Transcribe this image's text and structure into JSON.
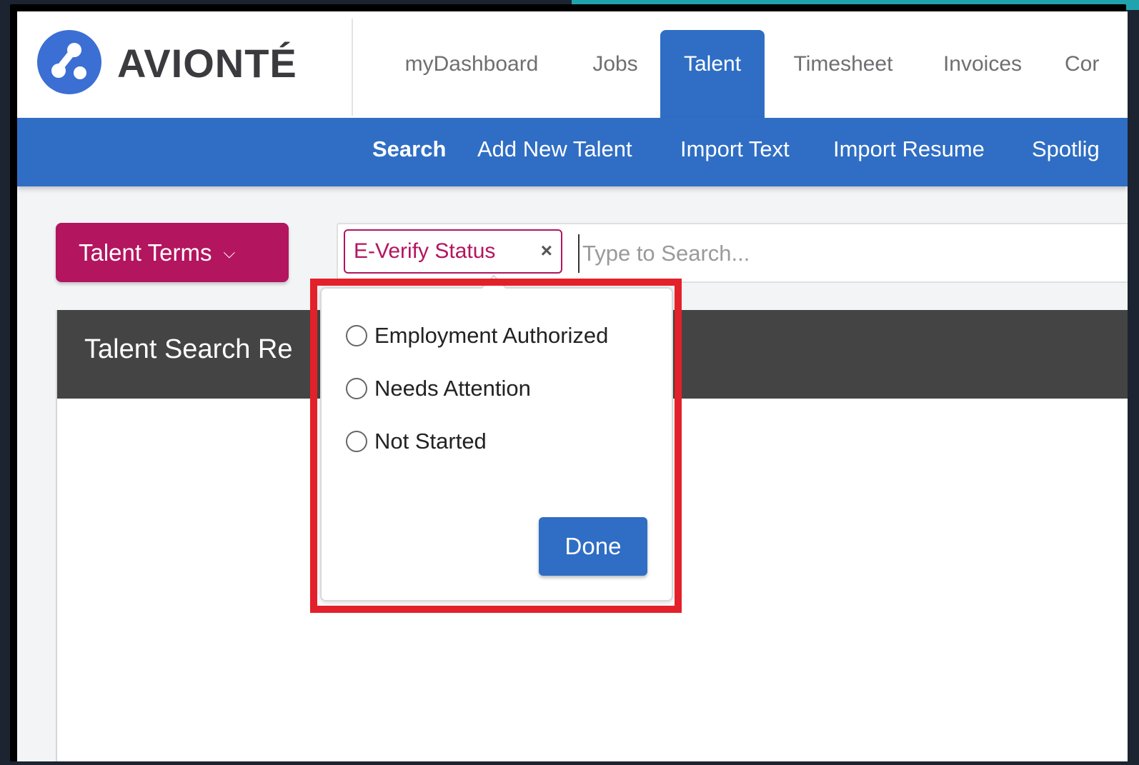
{
  "brand": {
    "name": "AVIONTÉ",
    "accent": "#2f6ec4",
    "secondary": "#b3155f"
  },
  "main_nav": {
    "tabs": [
      {
        "label": "myDashboard",
        "active": false
      },
      {
        "label": "Jobs",
        "active": false
      },
      {
        "label": "Talent",
        "active": true
      },
      {
        "label": "Timesheet",
        "active": false
      },
      {
        "label": "Invoices",
        "active": false
      },
      {
        "label": "Cor",
        "active": false
      }
    ]
  },
  "sub_nav": {
    "links": [
      {
        "label": "Search",
        "active": true
      },
      {
        "label": "Add New Talent",
        "active": false
      },
      {
        "label": "Import Text",
        "active": false
      },
      {
        "label": "Import Resume",
        "active": false
      },
      {
        "label": "Spotlig",
        "active": false
      }
    ]
  },
  "toolbar": {
    "talent_terms_label": "Talent Terms",
    "chip_label": "E-Verify Status",
    "chip_close": "×",
    "search_placeholder": "Type to Search..."
  },
  "results": {
    "title": "Talent Search Re"
  },
  "everify_popover": {
    "options": [
      {
        "label": "Employment Authorized",
        "selected": false
      },
      {
        "label": "Needs Attention",
        "selected": false
      },
      {
        "label": "Not Started",
        "selected": false
      }
    ],
    "done_label": "Done",
    "highlight_color": "#e3212a"
  },
  "icons": {
    "logo": "avionte-logo-icon",
    "chevron": "chevron-down-icon",
    "close": "close-icon"
  }
}
